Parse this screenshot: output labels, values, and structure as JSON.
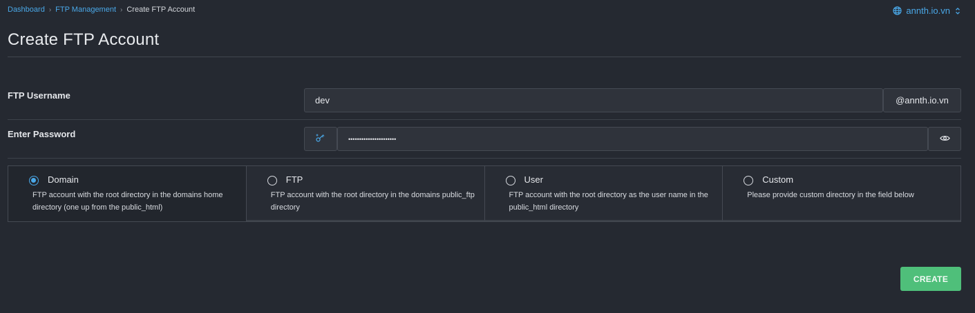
{
  "breadcrumb": {
    "items": [
      "Dashboard",
      "FTP Management"
    ],
    "current": "Create FTP Account"
  },
  "domain_selector": {
    "value": "annth.io.vn",
    "icon": "globe-icon"
  },
  "page": {
    "title": "Create FTP Account"
  },
  "form": {
    "username_label": "FTP Username",
    "username_value": "dev",
    "domain_suffix": "@annth.io.vn",
    "password_label": "Enter Password",
    "password_value": "••••••••••••••••••••••",
    "generate_icon": "key-generate-icon",
    "toggle_icon": "eye-icon"
  },
  "directory_options": [
    {
      "title": "Domain",
      "description": "FTP account with the root directory in the domains home directory (one up from the public_html)",
      "selected": true
    },
    {
      "title": "FTP",
      "description": "FTP account with the root directory in the domains public_ftp directory",
      "selected": false
    },
    {
      "title": "User",
      "description": "FTP account with the root directory as the user name in the public_html directory",
      "selected": false
    },
    {
      "title": "Custom",
      "description": "Please provide custom directory in the field below",
      "selected": false
    }
  ],
  "actions": {
    "create_label": "CREATE"
  },
  "colors": {
    "accent": "#4aa8e8",
    "success": "#4fbf7a",
    "background": "#252931"
  }
}
